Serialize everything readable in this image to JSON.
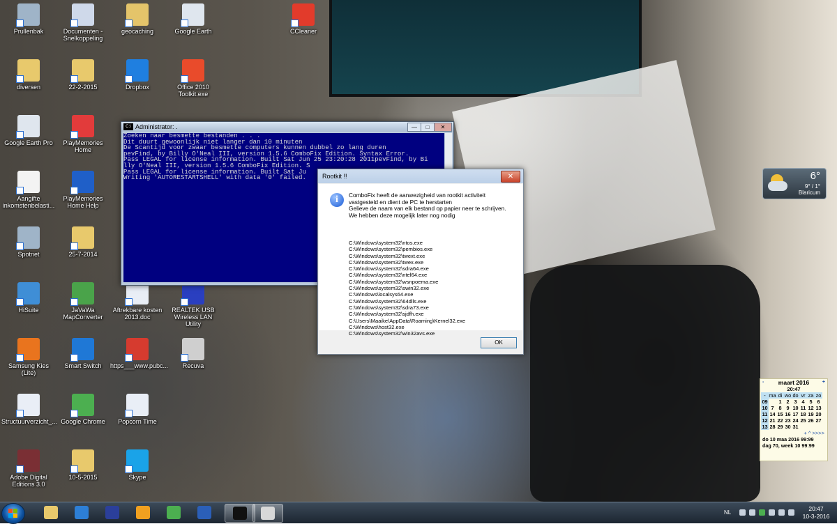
{
  "desktop_icons": [
    {
      "label": "Prullenbak",
      "color": "#9fb4c8"
    },
    {
      "label": "Documenten - Snelkoppeling",
      "color": "#cfd9ea"
    },
    {
      "label": "geocaching",
      "color": "#e4c46a"
    },
    {
      "label": "Google Earth",
      "color": "#dfe6ee"
    },
    {
      "label": "CCleaner",
      "color": "#e23b2b"
    },
    {
      "label": "diversen",
      "color": "#e8c96c"
    },
    {
      "label": "22-2-2015",
      "color": "#e8c96c"
    },
    {
      "label": "Dropbox",
      "color": "#1f7fe0"
    },
    {
      "label": "Office 2010 Toolkit.exe",
      "color": "#e94b2b"
    },
    {
      "label": "Google Earth Pro",
      "color": "#dfe6ee"
    },
    {
      "label": "PlayMemories Home",
      "color": "#e23b3b"
    },
    {
      "label": "Aangifte inkomstenbelasti...",
      "color": "#f3f3f3"
    },
    {
      "label": "PlayMemories Home Help",
      "color": "#1f5fc8"
    },
    {
      "label": "Spotnet",
      "color": "#9fb4c8"
    },
    {
      "label": "25-7-2014",
      "color": "#e8c96c"
    },
    {
      "label": "HiSuite",
      "color": "#3f8ed6"
    },
    {
      "label": "JaVaWa MapConverter",
      "color": "#4aa34a"
    },
    {
      "label": "Aftrekbare kosten 2013.doc",
      "color": "#e9eef6"
    },
    {
      "label": "REALTEK USB Wireless LAN Utility",
      "color": "#2a3fc0"
    },
    {
      "label": "Samsung Kies (Lite)",
      "color": "#e9741e"
    },
    {
      "label": "Smart Switch",
      "color": "#1f78d6"
    },
    {
      "label": "https___www.pubc...",
      "color": "#d63b2f"
    },
    {
      "label": "Recuva",
      "color": "#cfcfcf"
    },
    {
      "label": "Structuurverzicht_...",
      "color": "#e9eef6"
    },
    {
      "label": "Google Chrome",
      "color": "#4caf50"
    },
    {
      "label": "Popcorn Time",
      "color": "#e9eef6"
    },
    {
      "label": "Adobe Digital Editions 3.0",
      "color": "#7a2f34"
    },
    {
      "label": "10-5-2015",
      "color": "#e8c96c"
    },
    {
      "label": "Skype",
      "color": "#1aa3e8"
    }
  ],
  "cmd_window": {
    "title": "Administrator:  .",
    "lines": [
      "Zoeken naar besmette bestanden . . .",
      "Dit duurt gewoonlijk niet langer dan 10 minuten",
      "De Scantijd voor zwaar besmette computers kunnen dubbel zo lang duren",
      "pevFind, by Billy O'Neal III, version 1.5.6 ComboFix Edition. Syntax Error.",
      "Pass LEGAL for license information. Built Sat Jun 25 23:20:28 2011pevFind, by Bi",
      "lly O'Neal III, version 1.5.6 ComboFix Edition. S",
      "Pass LEGAL for license information. Built Sat Ju",
      "Writing 'AUTORESTARTSHELL' with data '0' failed."
    ],
    "min": "—",
    "max": "□",
    "close": "✕"
  },
  "dialog": {
    "title": "Rootkit !!",
    "close": "✕",
    "message_1": "ComboFix heeft de aanwezigheid van rootkit activiteit vastgesteld en dient de PC te herstarten",
    "message_2": "Gelieve de naam van elk bestand op papier neer te schrijven. We hebben deze mogelijk later nog nodig",
    "files": [
      "C:\\Windows\\system32\\ntos.exe",
      "C:\\Windows\\system32\\pembios.exe",
      "C:\\Windows\\system32\\twext.exe",
      "C:\\Windows\\system32\\twex.exe",
      "C:\\Windows\\system32\\sdra64.exe",
      "C:\\Windows\\system32\\ntel64.exe",
      "C:\\Windows\\system32\\wsnpoema.exe",
      "C:\\Windows\\system32\\swin32.exe",
      "C:\\Windows\\localsys64.exe",
      "C:\\Windows\\system32\\64dlls.exe",
      "C:\\Windows\\system32\\sdra73.exe",
      "C:\\Windows\\system32\\sjdfh.exe",
      "C:\\Users\\Maaike\\AppData\\Roaming\\Kernel32.exe",
      "C:\\Windows\\host32.exe",
      "C:\\Windows\\system32\\win32avs.exe"
    ],
    "ok": "OK"
  },
  "weather": {
    "temp": "6°",
    "range": "9° / 1°",
    "city": "Blaricum"
  },
  "calendar": {
    "month": "maart 2016",
    "time": "20:47",
    "prev": "-",
    "next": "+",
    "days": [
      "ma",
      "di",
      "wo",
      "do",
      "vr",
      "za",
      "zo"
    ],
    "weeks": [
      {
        "wk": "09",
        "d": [
          "",
          "1",
          "2",
          "3",
          "4",
          "5",
          "6"
        ]
      },
      {
        "wk": "10",
        "d": [
          "7",
          "8",
          "9",
          "10",
          "11",
          "12",
          "13"
        ]
      },
      {
        "wk": "11",
        "d": [
          "14",
          "15",
          "16",
          "17",
          "18",
          "19",
          "20"
        ]
      },
      {
        "wk": "12",
        "d": [
          "21",
          "22",
          "23",
          "24",
          "25",
          "26",
          "27"
        ]
      },
      {
        "wk": "13",
        "d": [
          "28",
          "29",
          "30",
          "31",
          "",
          "",
          ""
        ]
      }
    ],
    "nav": "+  ^ >>>>",
    "line1": "do 10 maa 2016   99:99",
    "line2": "dag 70, week 10   99:99"
  },
  "taskbar": {
    "apps": [
      {
        "name": "explorer",
        "color": "#e8c96c"
      },
      {
        "name": "internet-explorer",
        "color": "#2d7fd6"
      },
      {
        "name": "save",
        "color": "#2b3f9a"
      },
      {
        "name": "outlook",
        "color": "#f0a020"
      },
      {
        "name": "chrome",
        "color": "#4caf50"
      },
      {
        "name": "word",
        "color": "#2b5fb8"
      },
      {
        "name": "cmd",
        "color": "#111111"
      },
      {
        "name": "combofix",
        "color": "#d8d8d8"
      }
    ],
    "lang": "NL",
    "time": "20:47",
    "date": "10-3-2016"
  }
}
